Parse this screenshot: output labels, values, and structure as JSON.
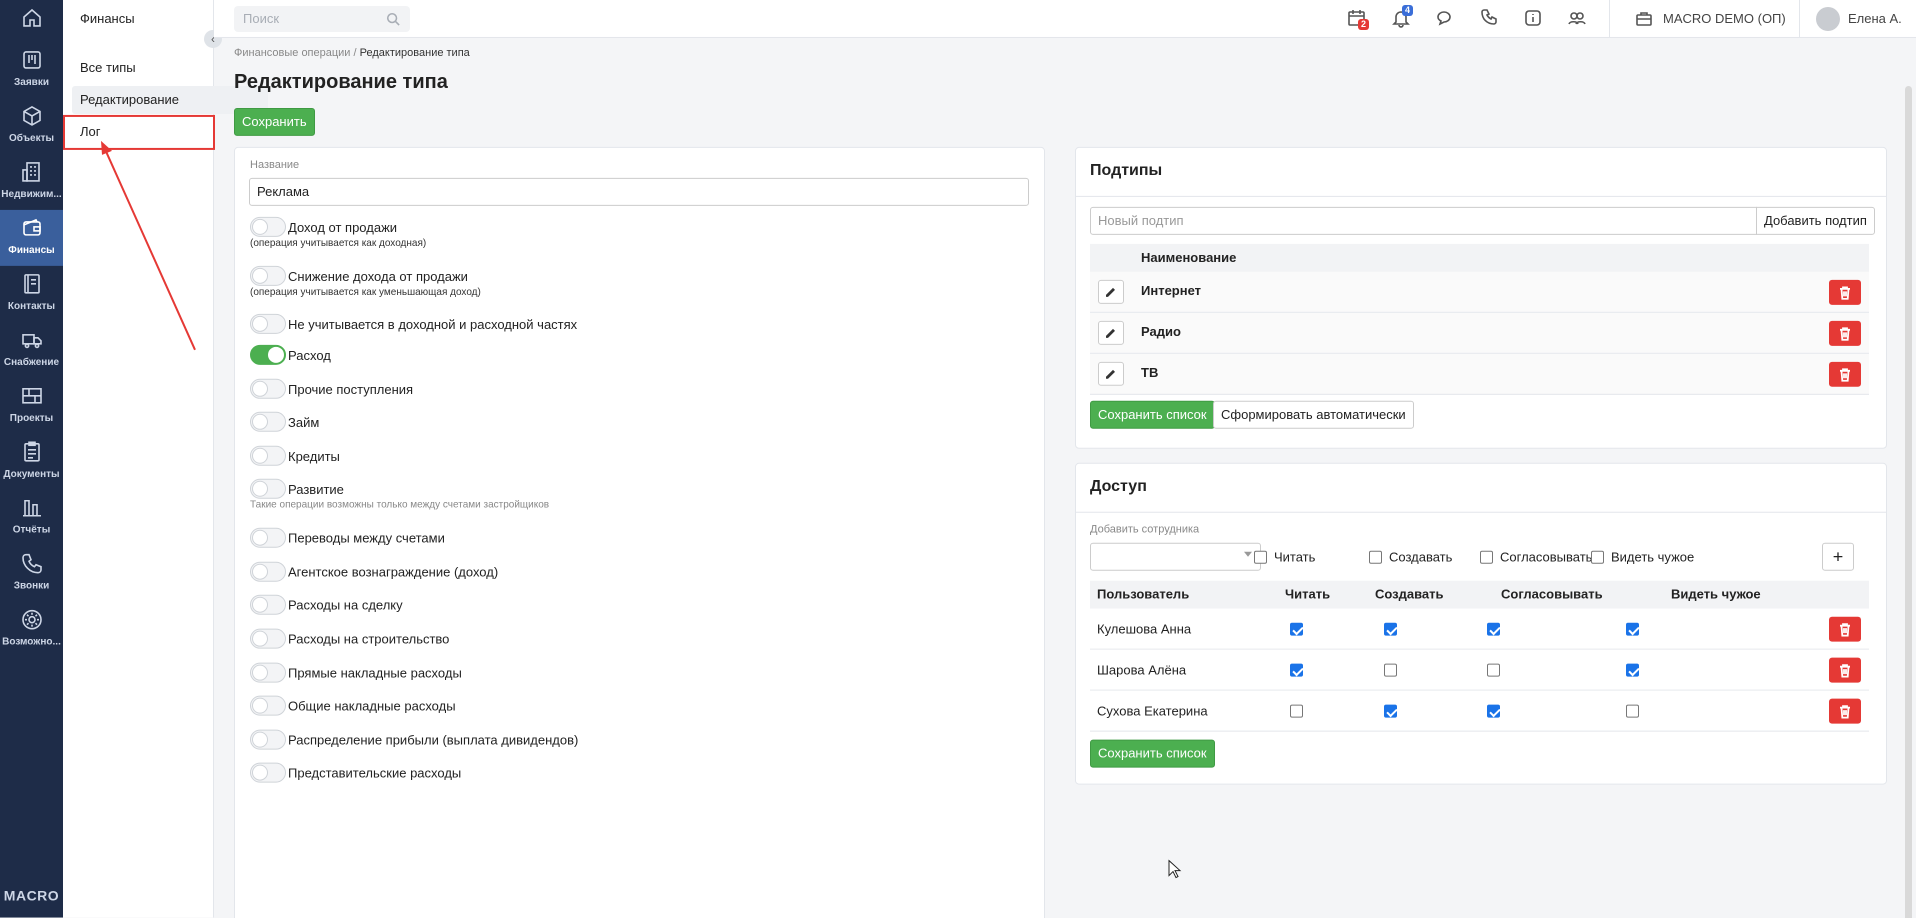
{
  "rail": {
    "items": [
      {
        "label": "",
        "icon": "home-icon"
      },
      {
        "label": "Заявки",
        "icon": "kanban-icon"
      },
      {
        "label": "Объекты",
        "icon": "cube-icon"
      },
      {
        "label": "Недвижим...",
        "icon": "building-icon"
      },
      {
        "label": "Финансы",
        "icon": "wallet-icon"
      },
      {
        "label": "Контакты",
        "icon": "contacts-icon"
      },
      {
        "label": "Снабжение",
        "icon": "truck-icon"
      },
      {
        "label": "Проекты",
        "icon": "grid-icon"
      },
      {
        "label": "Документы",
        "icon": "clipboard-icon"
      },
      {
        "label": "Отчёты",
        "icon": "bar-chart-icon"
      },
      {
        "label": "Звонки",
        "icon": "phone-icon"
      },
      {
        "label": "Возможно...",
        "icon": "gear-icon"
      }
    ],
    "logo": "MACRO"
  },
  "sidebar": {
    "title": "Финансы",
    "items": [
      {
        "label": "Все типы"
      },
      {
        "label": "Редактирование"
      },
      {
        "label": "Лог"
      }
    ]
  },
  "topbar": {
    "search_placeholder": "Поиск",
    "calendar_badge": "2",
    "bell_badge": "4",
    "company": "MACRO DEMO (ОП)",
    "user": "Елена А."
  },
  "breadcrumb": {
    "root": "Финансовые операции",
    "sep": "/",
    "current": "Редактирование типа"
  },
  "page_title": "Редактирование типа",
  "save_label": "Сохранить",
  "form": {
    "name_label": "Название",
    "name_value": "Реклама",
    "toggles": [
      {
        "label": "Доход от продажи",
        "on": false,
        "hint": "(операция учитывается как доходная)"
      },
      {
        "label": "Снижение дохода от продажи",
        "on": false,
        "hint": "(операция учитывается как уменьшающая доход)"
      },
      {
        "label": "Не учитывается в доходной и расходной частях",
        "on": false,
        "hint": ""
      },
      {
        "label": "Расход",
        "on": true,
        "hint": ""
      },
      {
        "label": "Прочие поступления",
        "on": false,
        "hint": ""
      },
      {
        "label": "Займ",
        "on": false,
        "hint": ""
      },
      {
        "label": "Кредиты",
        "on": false,
        "hint": ""
      },
      {
        "label": "Развитие",
        "on": false,
        "hint": "Такие операции возможны только между счетами застройщиков"
      },
      {
        "label": "Переводы между счетами",
        "on": false,
        "hint": ""
      },
      {
        "label": "Агентское вознаграждение (доход)",
        "on": false,
        "hint": ""
      },
      {
        "label": "Расходы на сделку",
        "on": false,
        "hint": ""
      },
      {
        "label": "Расходы на строительство",
        "on": false,
        "hint": ""
      },
      {
        "label": "Прямые накладные расходы",
        "on": false,
        "hint": ""
      },
      {
        "label": "Общие накладные расходы",
        "on": false,
        "hint": ""
      },
      {
        "label": "Распределение прибыли (выплата дивидендов)",
        "on": false,
        "hint": ""
      },
      {
        "label": "Представительские расходы",
        "on": false,
        "hint": ""
      }
    ]
  },
  "subtypes": {
    "title": "Подтипы",
    "new_placeholder": "Новый подтип",
    "add_label": "Добавить подтип",
    "column": "Наименование",
    "rows": [
      {
        "name": "Интернет"
      },
      {
        "name": "Радио"
      },
      {
        "name": "ТВ"
      }
    ],
    "save_list": "Сохранить список",
    "auto": "Сформировать автоматически"
  },
  "access": {
    "title": "Доступ",
    "add_label": "Добавить сотрудника",
    "filters": [
      "Читать",
      "Создавать",
      "Согласовывать",
      "Видеть чужое"
    ],
    "columns": [
      "Пользователь",
      "Читать",
      "Создавать",
      "Согласовывать",
      "Видеть чужое"
    ],
    "rows": [
      {
        "user": "Кулешова Анна",
        "perms": [
          true,
          true,
          true,
          true
        ]
      },
      {
        "user": "Шарова Алёна",
        "perms": [
          true,
          false,
          false,
          true
        ]
      },
      {
        "user": "Сухова Екатерина",
        "perms": [
          false,
          true,
          true,
          false
        ]
      }
    ],
    "save_list": "Сохранить список"
  },
  "colors": {
    "accent": "#4caf50",
    "danger": "#e53935",
    "rail": "#1e2c48",
    "rail_active": "#3a5f9c"
  }
}
